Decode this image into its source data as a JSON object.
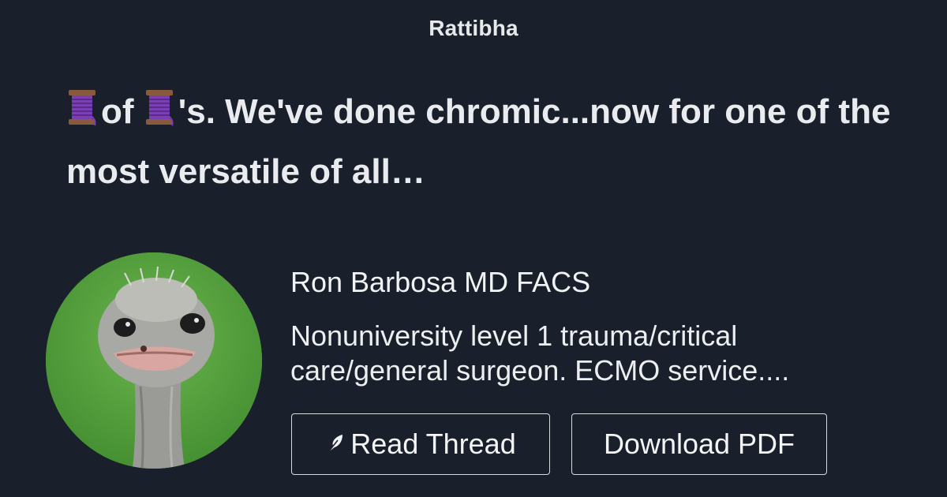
{
  "brand": "Rattibha",
  "thread": {
    "title_part1": "of",
    "title_part2": "'s. We've done chromic...now for one of the most versatile of all…",
    "emoji": "spool-of-thread-icon"
  },
  "author": {
    "name": "Ron Barbosa MD FACS",
    "bio": "Nonuniversity level 1 trauma/critical care/general surgeon. ECMO service....",
    "avatar": "ostrich-avatar"
  },
  "actions": {
    "read_label": "Read Thread",
    "read_icon": "feather-icon",
    "pdf_label": "Download PDF"
  },
  "colors": {
    "background": "#19202b",
    "text": "#e8eaed",
    "button_border": "#d8dade"
  }
}
